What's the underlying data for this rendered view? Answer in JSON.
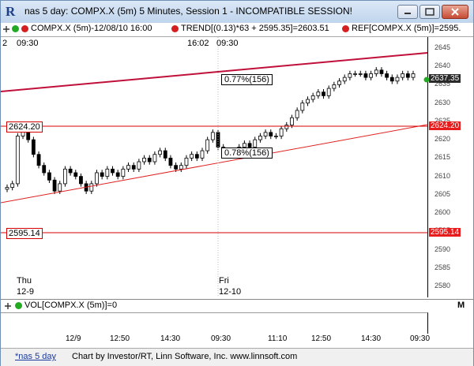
{
  "window": {
    "icon": "R",
    "title": "nas 5 day: COMPX.X (5m) 5 Minutes, Session 1 - INCOMPATIBLE SESSION!",
    "buttons": {
      "minimize": "minimize-icon",
      "maximize": "maximize-icon",
      "close": "close-icon"
    }
  },
  "toolbar": {
    "series_label": "COMPX.X (5m)-12/08/10 16:00",
    "trend_label": "TREND[(0.13)*63 + 2595.35]=2603.51",
    "ref_label": "REF[COMPX.X (5m)]=2595.",
    "m_label": "M"
  },
  "time_strip": {
    "left_time": "09:30",
    "left_prefix": "2",
    "mid_time": "16:02",
    "mid_time2": "09:30"
  },
  "chart": {
    "annotations": {
      "upper_channel_label": "0.77%(156)",
      "lower_channel_label": "0.78%(156)",
      "level_2624": "2624.20",
      "level_2595": "2595.14",
      "axis_tag_last": "2637.35",
      "axis_tag_2624": "2624.20",
      "axis_tag_2595": "2595.14"
    },
    "day_labels": {
      "day1_name": "Thu",
      "day1_date": "12-9",
      "day2_name": "Fri",
      "day2_date": "12-10"
    }
  },
  "chart_data": {
    "type": "candlestick",
    "y_ticks": [
      "2645",
      "2640",
      "2635",
      "2630",
      "2625",
      "2620",
      "2615",
      "2610",
      "2605",
      "2600",
      "2595",
      "2590",
      "2585",
      "2580"
    ],
    "ylim": [
      2577,
      2648
    ],
    "x_ticks": [
      "12/9",
      "12:50",
      "14:30",
      "09:30",
      "11:10",
      "12:50",
      "14:30",
      "09:30"
    ],
    "closes": [
      2607,
      2608,
      2621,
      2623,
      2620,
      2616,
      2613,
      2611,
      2609,
      2606,
      2608,
      2612,
      2611,
      2610,
      2608,
      2606,
      2608,
      2611,
      2610,
      2612,
      2611,
      2610,
      2612,
      2613,
      2612,
      2614,
      2615,
      2614,
      2616,
      2617,
      2615,
      2613,
      2612,
      2613,
      2615,
      2616,
      2615,
      2617,
      2620,
      2622,
      2618,
      2616,
      2617,
      2616,
      2618,
      2619,
      2618,
      2620,
      2621,
      2622,
      2621,
      2621,
      2623,
      2624,
      2626,
      2628,
      2630,
      2631,
      2632,
      2633,
      2632,
      2634,
      2635,
      2636,
      2637,
      2638,
      2638,
      2638,
      2637,
      2638,
      2639,
      2638,
      2637,
      2636,
      2637,
      2638,
      2637,
      2638
    ]
  },
  "lower_panel": {
    "indicator_label": "VOL[COMPX.X (5m)]=0",
    "m_label": "M"
  },
  "footer": {
    "tab_label": "*nas 5 day",
    "credit": "Chart by Investor/RT, Linn Software, Inc. www.linnsoft.com"
  },
  "colors": {
    "upper_channel": "#c0103a",
    "lower_channel": "#e02020",
    "ref_line": "#d40000",
    "last_price_tag": "#2a2a2a",
    "green_dot": "#22aa22",
    "red_dot": "#d42020"
  }
}
